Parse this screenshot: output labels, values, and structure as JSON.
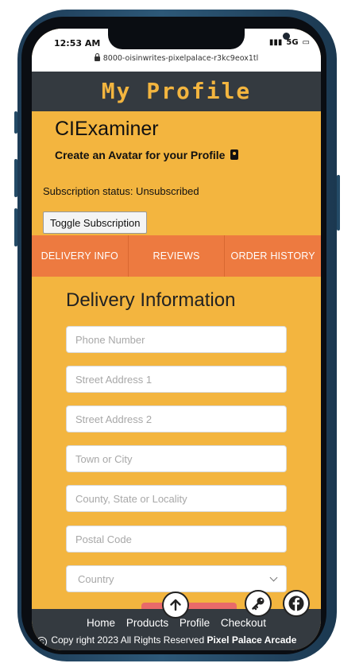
{
  "statusbar": {
    "time": "12:53 AM",
    "signal": "5G",
    "url": "8000-oisinwrites-pixelpalace-r3kc9eox1tl"
  },
  "header": {
    "title": "My Profile"
  },
  "profile": {
    "username": "CIExaminer",
    "avatar_link": "Create an Avatar for your Profile",
    "subscription_status": "Subscription status: Unsubscribed",
    "toggle_button": "Toggle Subscription"
  },
  "tabs": [
    {
      "label": "DELIVERY INFO"
    },
    {
      "label": "REVIEWS"
    },
    {
      "label": "ORDER HISTORY"
    }
  ],
  "delivery": {
    "title": "Delivery Information",
    "phone_placeholder": "Phone Number",
    "street1_placeholder": "Street Address 1",
    "street2_placeholder": "Street Address 2",
    "town_placeholder": "Town or City",
    "county_placeholder": "County, State or Locality",
    "postcode_placeholder": "Postal Code",
    "country_selected": "Country"
  },
  "footer": {
    "links": [
      "Home",
      "Products",
      "Profile",
      "Checkout"
    ],
    "copyright": "Copy right 2023 All Rights Reserved",
    "brand": "Pixel Palace Arcade"
  },
  "icons": {
    "back_to_top": "arrow-up-icon",
    "key": "key-icon",
    "facebook": "facebook-icon"
  },
  "colors": {
    "page_bg": "#f3b53f",
    "header_bg": "#343a40",
    "title_color": "#f3b53f",
    "tabs_bg": "#ed7a40"
  }
}
